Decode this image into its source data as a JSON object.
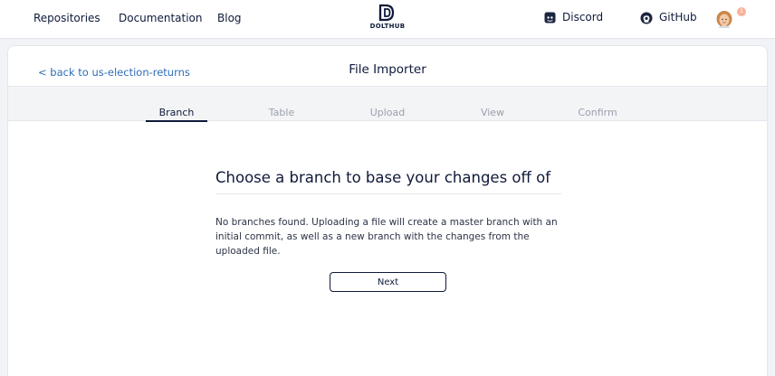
{
  "nav": {
    "repositories": "Repositories",
    "documentation": "Documentation",
    "blog": "Blog",
    "logo_text": "DOLTHUB",
    "discord": "Discord",
    "github": "GitHub",
    "notification_count": "1",
    "icons": [
      "dolthub-logo-icon",
      "discord-icon",
      "github-icon",
      "avatar"
    ]
  },
  "header": {
    "back_link": "< back to us-election-returns",
    "title": "File Importer"
  },
  "steps": [
    {
      "label": "Branch",
      "active": true
    },
    {
      "label": "Table",
      "active": false
    },
    {
      "label": "Upload",
      "active": false
    },
    {
      "label": "View",
      "active": false
    },
    {
      "label": "Confirm",
      "active": false
    }
  ],
  "main": {
    "heading": "Choose a branch to base your changes off of",
    "message": "No branches found. Uploading a file will create a master branch with an initial commit, as well as a new branch with the changes from the uploaded file.",
    "next_button": "Next"
  },
  "colors": {
    "primary": "#0f1a3a",
    "link": "#2f6db5",
    "inactive_step": "#9aa1ad",
    "background": "#f1f3f6",
    "notification": "#f7b39a"
  }
}
